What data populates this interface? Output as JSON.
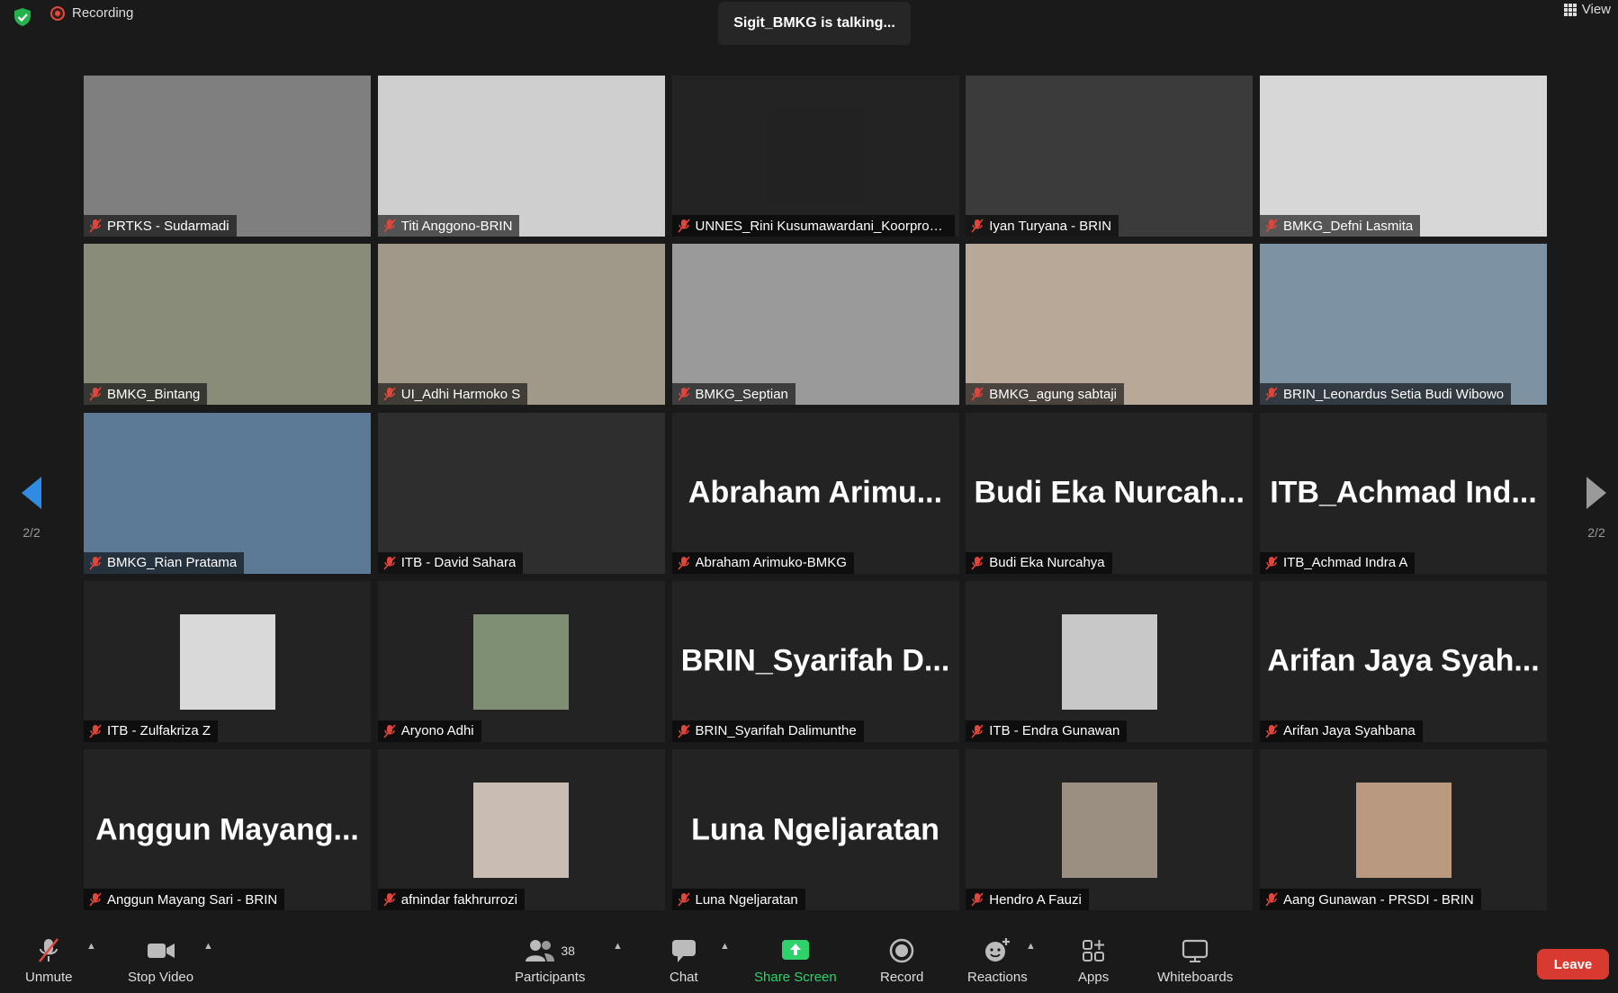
{
  "app": {
    "recording_label": "Recording",
    "talking_banner": "Sigit_BMKG is talking...",
    "view_label": "View",
    "page_indicator": "2/2"
  },
  "colors": {
    "background": "#1a1a1a",
    "share_green": "#2fd16b",
    "leave_red": "#d83a2f",
    "muted_red": "#e0463c"
  },
  "participants": [
    {
      "name": "PRTKS - Sudarmadi",
      "kind": "video",
      "bg": "#7f7f7f"
    },
    {
      "name": "Titi Anggono-BRIN",
      "kind": "video",
      "bg": "#cfcfcf"
    },
    {
      "name": "UNNES_Rini Kusumawardani_Koorprod...",
      "kind": "photo-video",
      "bg": "#222222"
    },
    {
      "name": "Iyan Turyana - BRIN",
      "kind": "video",
      "bg": "#3b3b3b"
    },
    {
      "name": "BMKG_Defni Lasmita",
      "kind": "video",
      "bg": "#d7d7d7"
    },
    {
      "name": "BMKG_Bintang",
      "kind": "video",
      "bg": "#8a8c7a"
    },
    {
      "name": "UI_Adhi Harmoko S",
      "kind": "video",
      "bg": "#a09888"
    },
    {
      "name": "BMKG_Septian",
      "kind": "video",
      "bg": "#9a9a9a"
    },
    {
      "name": "BMKG_agung sabtaji",
      "kind": "video",
      "bg": "#b8a898"
    },
    {
      "name": "BRIN_Leonardus Setia Budi Wibowo",
      "kind": "video",
      "bg": "#7d93a3"
    },
    {
      "name": "BMKG_Rian Pratama",
      "kind": "video",
      "bg": "#5c7a96"
    },
    {
      "name": "ITB - David Sahara",
      "kind": "video",
      "bg": "#2e2e2e"
    },
    {
      "name": "Abraham Arimuko-BMKG",
      "kind": "text",
      "display": "Abraham Arimu..."
    },
    {
      "name": "Budi Eka Nurcahya",
      "kind": "text",
      "display": "Budi Eka Nurcah..."
    },
    {
      "name": "ITB_Achmad Indra A",
      "kind": "text",
      "display": "ITB_Achmad Ind..."
    },
    {
      "name": "ITB - Zulfakriza Z",
      "kind": "photo",
      "bg": "#d9d9d9"
    },
    {
      "name": "Aryono Adhi",
      "kind": "photo",
      "bg": "#7e8f73"
    },
    {
      "name": "BRIN_Syarifah Dalimunthe",
      "kind": "text",
      "display": "BRIN_Syarifah D..."
    },
    {
      "name": "ITB - Endra Gunawan",
      "kind": "photo",
      "bg": "#c8c8c8"
    },
    {
      "name": "Arifan Jaya Syahbana",
      "kind": "text",
      "display": "Arifan Jaya Syah..."
    },
    {
      "name": "Anggun Mayang Sari - BRIN",
      "kind": "text",
      "display": "Anggun Mayang..."
    },
    {
      "name": "afnindar fakhrurrozi",
      "kind": "photo",
      "bg": "#c9bdb3"
    },
    {
      "name": "Luna Ngeljaratan",
      "kind": "text",
      "display": "Luna Ngeljaratan"
    },
    {
      "name": "Hendro A Fauzi",
      "kind": "photo",
      "bg": "#9a8f80"
    },
    {
      "name": "Aang Gunawan - PRSDI - BRIN",
      "kind": "photo",
      "bg": "#b99a80"
    }
  ],
  "toolbar": {
    "unmute": "Unmute",
    "stop_video": "Stop Video",
    "participants": "Participants",
    "participants_count": "38",
    "chat": "Chat",
    "share_screen": "Share Screen",
    "record": "Record",
    "reactions": "Reactions",
    "apps": "Apps",
    "whiteboards": "Whiteboards",
    "leave": "Leave"
  }
}
